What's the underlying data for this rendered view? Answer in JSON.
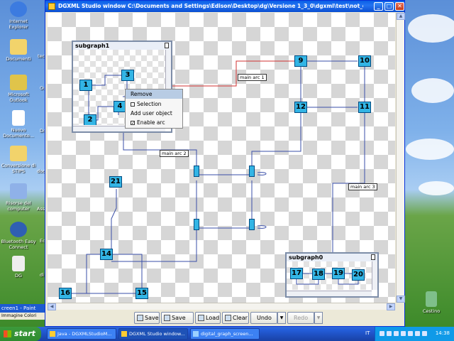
{
  "desktop": {
    "icons": [
      {
        "label": "Internet Explorer",
        "color": "#3c7be0"
      },
      {
        "label": "Documenti",
        "color": "#f2d36b"
      },
      {
        "label": "Microsoft Outlook",
        "color": "#e0c44a"
      },
      {
        "label": "Nuovo Documento...",
        "color": "#ffffff"
      },
      {
        "label": "Conversione di STIPS",
        "color": "#f2d36b"
      },
      {
        "label": "Risorse del computer",
        "color": "#8fb1e8"
      },
      {
        "label": "Bluetooth Easy Connect",
        "color": "#2f5fb3"
      },
      {
        "label": "DG",
        "color": "#eeeeee"
      }
    ],
    "partial_labels": [
      "tec",
      "Mi",
      "Ou",
      "N",
      "Do",
      "docu",
      "Ri",
      "Asse",
      "Ed",
      "di"
    ],
    "recycle_bin_label": "Cestino",
    "left_strip_labels": [
      "creen1 - Paint",
      "Immagine  Colori"
    ]
  },
  "window": {
    "title": "DGXML Studio window C:\\Documents and Settings\\Edison\\Desktop\\dg\\Versione 1_3_0\\dgxml\\test\\not_oriented\\...",
    "minimize_label": "_",
    "maximize_label": "□",
    "close_label": "✕"
  },
  "graph": {
    "nodes": [
      {
        "id": "9",
        "label": "9"
      },
      {
        "id": "10",
        "label": "10"
      },
      {
        "id": "12",
        "label": "12"
      },
      {
        "id": "11",
        "label": "11"
      },
      {
        "id": "21",
        "label": "21"
      },
      {
        "id": "14",
        "label": "14"
      },
      {
        "id": "16",
        "label": "16"
      },
      {
        "id": "15",
        "label": "15"
      }
    ],
    "edge_labels": [
      "main arc 1",
      "main arc 2",
      "main arc 3"
    ],
    "subgraph1": {
      "title": "subgraph1",
      "nodes": [
        "1",
        "3",
        "2",
        "4"
      ]
    },
    "subgraph0": {
      "title": "subgraph0",
      "nodes": [
        "17",
        "18",
        "19",
        "20"
      ]
    }
  },
  "context_menu": {
    "items": [
      {
        "label": "Remove",
        "highlighted": true
      },
      {
        "label": "Selection",
        "checkbox": true,
        "checked": false
      },
      {
        "label": "Add user object"
      },
      {
        "label": "Enable arc",
        "checkbox": true,
        "checked": true
      }
    ],
    "unchecked_mark": "",
    "checked_mark": "✓"
  },
  "toolbar": {
    "save": "Save",
    "save_as": "Save as",
    "load": "Load",
    "clear": "Clear",
    "undo": "Undo",
    "redo": "Redo",
    "dropdown_glyph": "▼"
  },
  "taskbar": {
    "start_label": "start",
    "tasks": [
      {
        "label": "Java - DGXMLStudioM..."
      },
      {
        "label": "DGXML Studio window..."
      },
      {
        "label": "digital_graph_screen..."
      }
    ],
    "language": "IT",
    "clock": "14:38"
  }
}
